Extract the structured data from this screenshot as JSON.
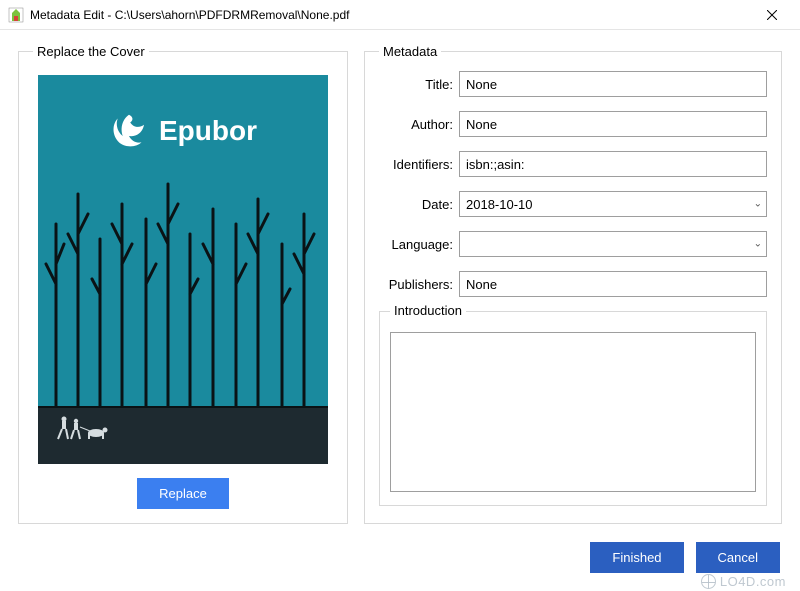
{
  "window": {
    "title": "Metadata Edit - C:\\Users\\ahorn\\PDFDRMRemoval\\None.pdf"
  },
  "cover": {
    "legend": "Replace the Cover",
    "brand": "Epubor",
    "replace_label": "Replace"
  },
  "metadata": {
    "legend": "Metadata",
    "labels": {
      "title": "Title:",
      "author": "Author:",
      "identifiers": "Identifiers:",
      "date": "Date:",
      "language": "Language:",
      "publishers": "Publishers:",
      "introduction": "Introduction"
    },
    "values": {
      "title": "None",
      "author": "None",
      "identifiers": "isbn:;asin:",
      "date": "2018-10-10",
      "language": "",
      "publishers": "None",
      "introduction": ""
    }
  },
  "footer": {
    "finished": "Finished",
    "cancel": "Cancel"
  },
  "watermark": "LO4D.com"
}
